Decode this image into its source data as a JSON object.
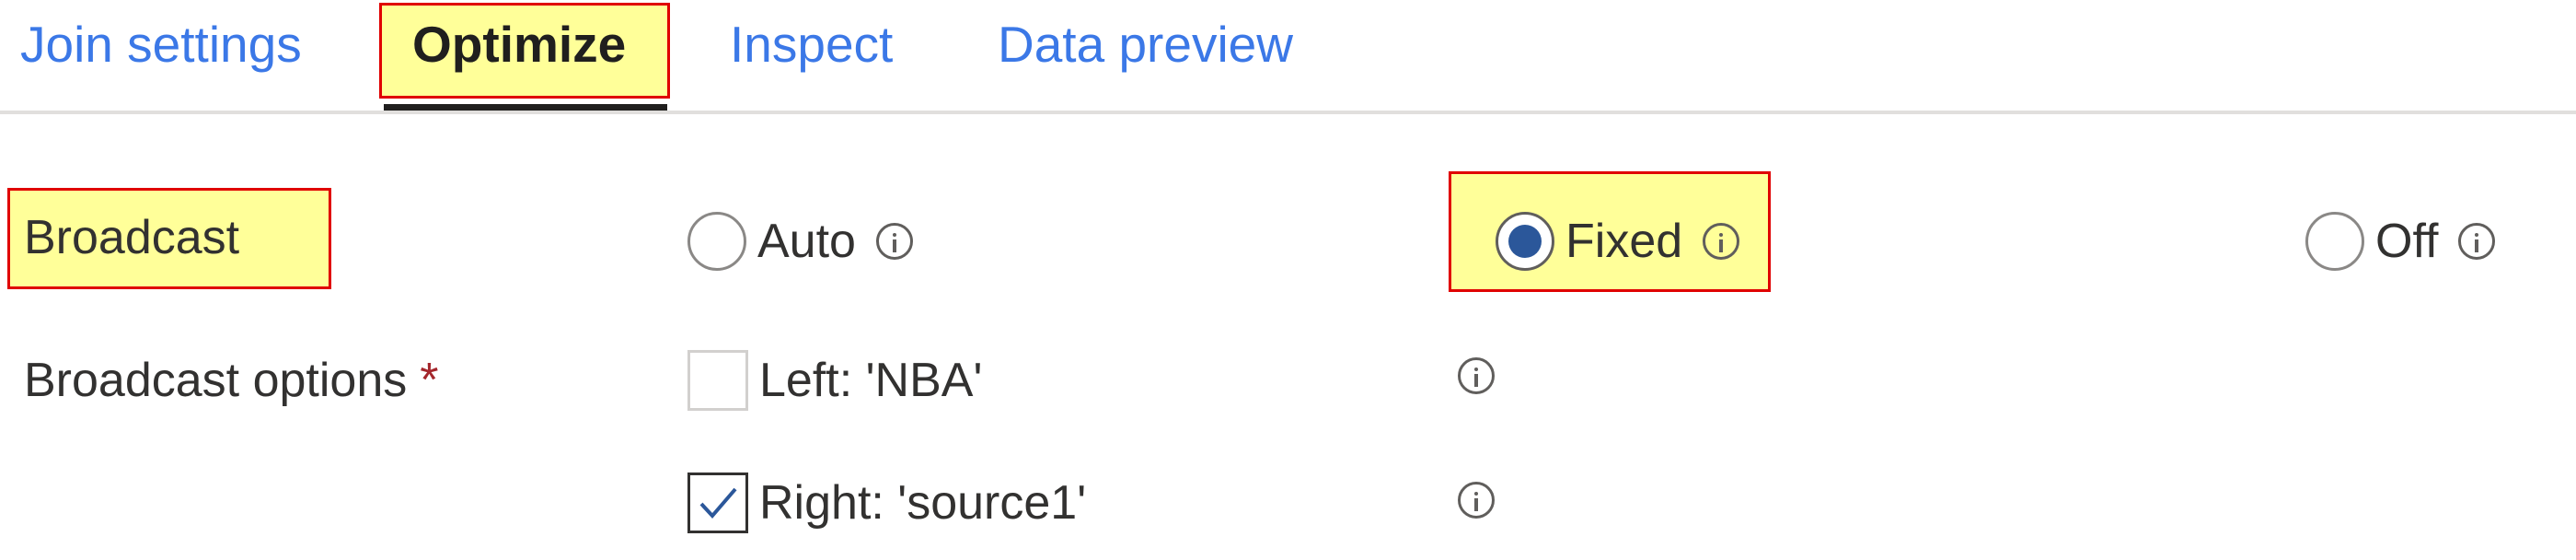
{
  "tabs": [
    {
      "label": "Join settings",
      "active": false
    },
    {
      "label": "Optimize",
      "active": true
    },
    {
      "label": "Inspect",
      "active": false
    },
    {
      "label": "Data preview",
      "active": false
    }
  ],
  "form": {
    "broadcast": {
      "label": "Broadcast",
      "options": [
        {
          "label": "Auto",
          "selected": false
        },
        {
          "label": "Fixed",
          "selected": true
        },
        {
          "label": "Off",
          "selected": false
        }
      ]
    },
    "broadcast_options": {
      "label": "Broadcast options",
      "required_marker": "*",
      "options": [
        {
          "label": "Left: 'NBA'",
          "checked": false
        },
        {
          "label": "Right: 'source1'",
          "checked": true
        }
      ]
    }
  },
  "icons": {
    "info": "info-icon",
    "check": "checkmark-icon"
  },
  "colors": {
    "link_blue": "#3b78e7",
    "radio_selected": "#2b579a",
    "highlight_fill": "#ffff99",
    "highlight_border": "#e00000",
    "required_red": "#a4262c"
  }
}
